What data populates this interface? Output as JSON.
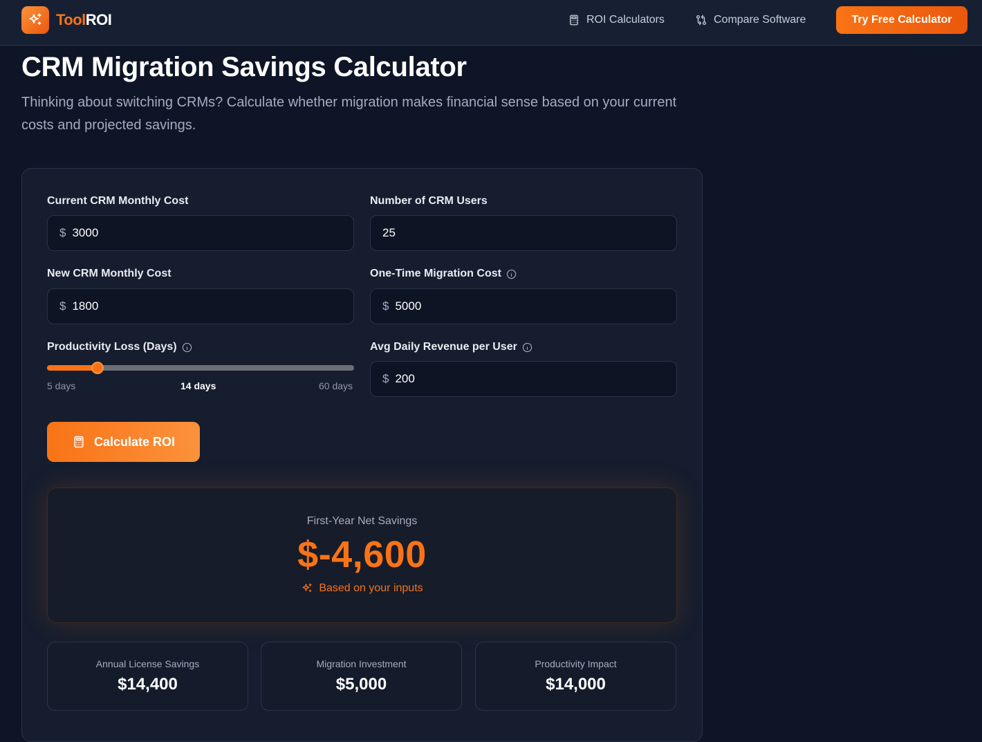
{
  "brand": {
    "name_part1": "Tool",
    "name_part2": "ROI",
    "accent": "#f97316"
  },
  "nav": {
    "links": [
      {
        "label": "ROI Calculators",
        "icon": "calculator-icon"
      },
      {
        "label": "Compare Software",
        "icon": "compare-icon"
      }
    ],
    "cta_label": "Try Free Calculator"
  },
  "header": {
    "title": "CRM Migration Savings Calculator",
    "subtitle": "Thinking about switching CRMs? Calculate whether migration makes financial sense based on your current costs and projected savings."
  },
  "form": {
    "current_cost": {
      "label": "Current CRM Monthly Cost",
      "prefix": "$",
      "value": "3000"
    },
    "users": {
      "label": "Number of CRM Users",
      "value": "25"
    },
    "new_cost": {
      "label": "New CRM Monthly Cost",
      "prefix": "$",
      "value": "1800"
    },
    "migration_cost": {
      "label": "One-Time Migration Cost",
      "prefix": "$",
      "value": "5000",
      "has_info": true
    },
    "productivity_loss": {
      "label": "Productivity Loss (Days)",
      "has_info": true,
      "min_label": "5 days",
      "current_label": "14 days",
      "max_label": "60 days",
      "min": 5,
      "max": 60,
      "value": 14
    },
    "daily_revenue": {
      "label": "Avg Daily Revenue per User",
      "prefix": "$",
      "value": "200",
      "has_info": true
    },
    "calculate_label": "Calculate ROI"
  },
  "result": {
    "label": "First-Year Net Savings",
    "value": "$-4,600",
    "note": "Based on your inputs"
  },
  "stats": [
    {
      "label": "Annual License Savings",
      "value": "$14,400"
    },
    {
      "label": "Migration Investment",
      "value": "$5,000"
    },
    {
      "label": "Productivity Impact",
      "value": "$14,000"
    }
  ]
}
